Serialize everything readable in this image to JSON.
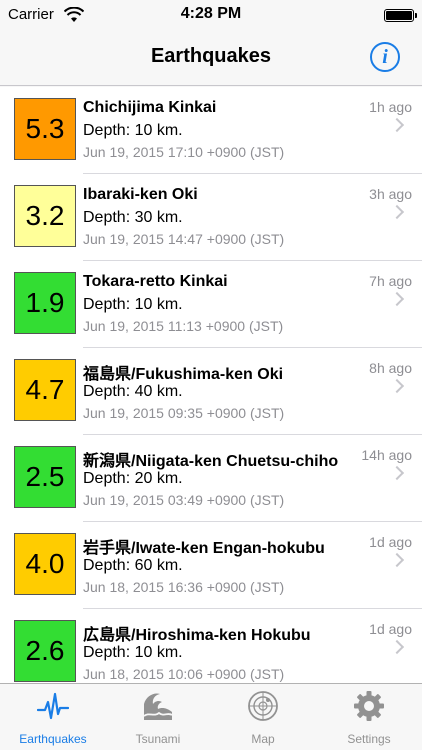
{
  "status_bar": {
    "carrier": "Carrier",
    "time": "4:28 PM"
  },
  "nav": {
    "title": "Earthquakes",
    "info_icon": "info-icon"
  },
  "quakes": [
    {
      "magnitude": "5.3",
      "color": "#ff9900",
      "place": "Chichijima Kinkai",
      "depth": "Depth: 10 km.",
      "datetime": "Jun 19, 2015 17:10 +0900 (JST)",
      "ago": "1h ago"
    },
    {
      "magnitude": "3.2",
      "color": "#ffff99",
      "place": "Ibaraki-ken Oki",
      "depth": "Depth: 30 km.",
      "datetime": "Jun 19, 2015 14:47 +0900 (JST)",
      "ago": "3h ago"
    },
    {
      "magnitude": "1.9",
      "color": "#33dd33",
      "place": "Tokara-retto Kinkai",
      "depth": "Depth: 10 km.",
      "datetime": "Jun 19, 2015 11:13 +0900 (JST)",
      "ago": "7h ago"
    },
    {
      "magnitude": "4.7",
      "color": "#ffcc00",
      "place": "福島県/Fukushima-ken Oki",
      "depth": "Depth: 40 km.",
      "datetime": "Jun 19, 2015 09:35 +0900 (JST)",
      "ago": "8h ago"
    },
    {
      "magnitude": "2.5",
      "color": "#33dd33",
      "place": "新潟県/Niigata-ken Chuetsu-chiho",
      "depth": "Depth: 20 km.",
      "datetime": "Jun 19, 2015 03:49 +0900 (JST)",
      "ago": "14h ago"
    },
    {
      "magnitude": "4.0",
      "color": "#ffcc00",
      "place": "岩手県/Iwate-ken Engan-hokubu",
      "depth": "Depth: 60 km.",
      "datetime": "Jun 18, 2015 16:36 +0900 (JST)",
      "ago": "1d ago"
    },
    {
      "magnitude": "2.6",
      "color": "#33dd33",
      "place": "広島県/Hiroshima-ken Hokubu",
      "depth": "Depth: 10 km.",
      "datetime": "Jun 18, 2015 10:06 +0900 (JST)",
      "ago": "1d ago"
    }
  ],
  "tabs": [
    {
      "label": "Earthquakes",
      "icon": "seismograph-icon",
      "active": true
    },
    {
      "label": "Tsunami",
      "icon": "wave-icon",
      "active": false
    },
    {
      "label": "Map",
      "icon": "radar-icon",
      "active": false
    },
    {
      "label": "Settings",
      "icon": "gear-icon",
      "active": false
    }
  ],
  "colors": {
    "accent": "#1a7de6",
    "inactive": "#929292"
  }
}
